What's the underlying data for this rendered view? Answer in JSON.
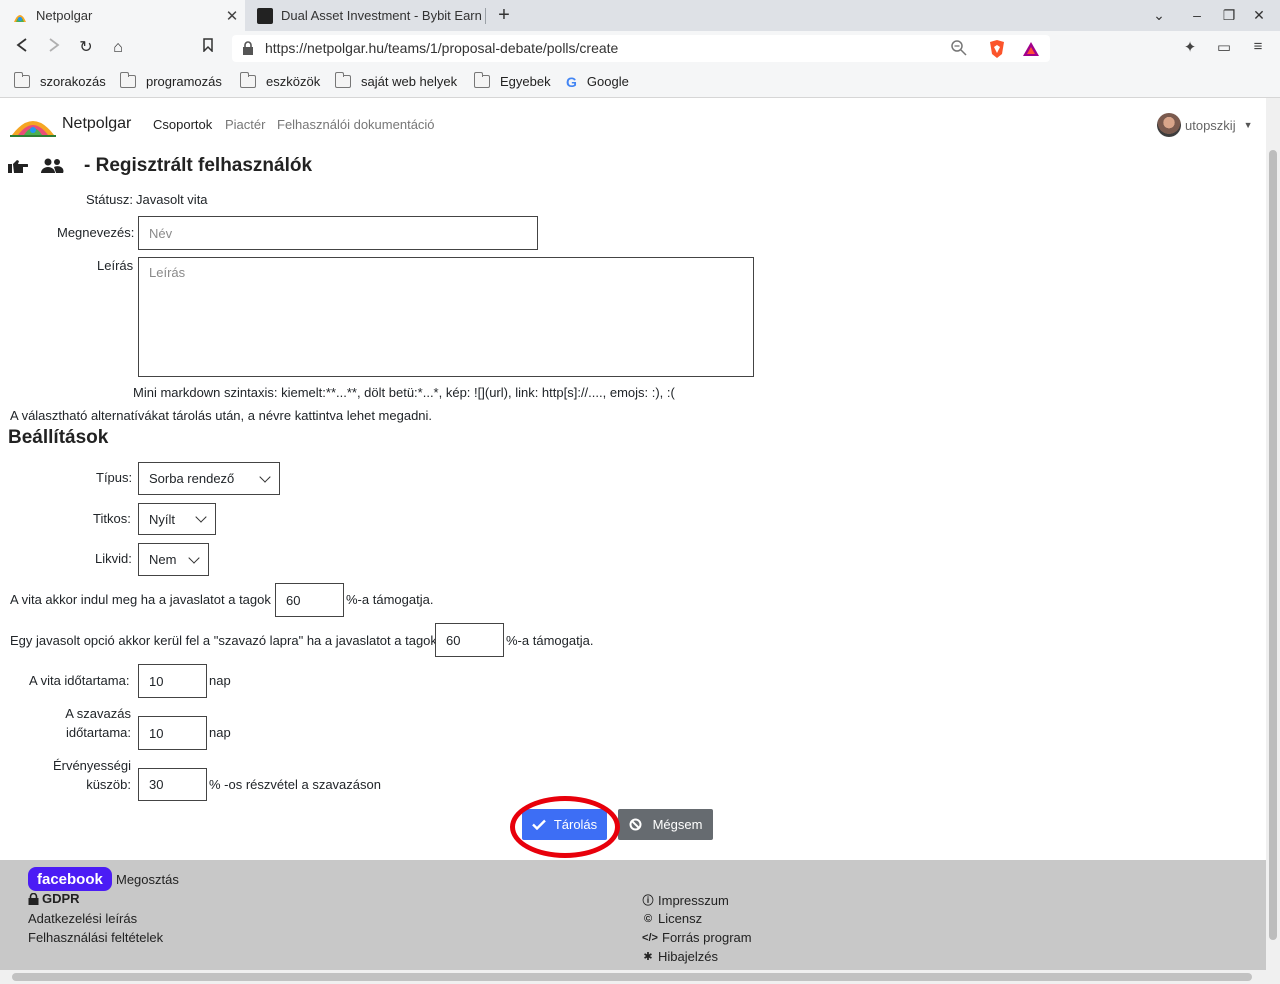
{
  "browser": {
    "tabs": [
      {
        "title": "Netpolgar",
        "active": true
      },
      {
        "title": "Dual Asset Investment - Bybit Earn",
        "active": false
      }
    ],
    "url": "https://netpolgar.hu/teams/1/proposal-debate/polls/create",
    "url_domain": "netpolgar.hu",
    "bookmarks": [
      "szorakozás",
      "programozás",
      "eszközök",
      "saját web helyek",
      "Egyebek",
      "Google"
    ]
  },
  "nav": {
    "brand": "Netpolgar",
    "links": [
      "Csoportok",
      "Piactér",
      "Felhasználói dokumentáció"
    ],
    "user": "utopszkij"
  },
  "header": {
    "title": "- Regisztrált felhasználók"
  },
  "form": {
    "status_label": "Státusz:",
    "status_value": "Javasolt vita",
    "name_label": "Megnevezés:",
    "name_placeholder": "Név",
    "desc_label": "Leírás",
    "desc_placeholder": "Leírás",
    "markdown_hint": "Mini markdown szintaxis: kiemelt:**...**, dölt betü:*...*, kép: ![](url), link: http[s]://...., emojs: :), :(",
    "alt_hint": "A választható alternatívákat tárolás után, a névre kattintva lehet megadni."
  },
  "settings": {
    "title": "Beállítások",
    "type_label": "Típus:",
    "type_value": "Sorba rendező",
    "secret_label": "Titkos:",
    "secret_value": "Nyílt",
    "liquid_label": "Likvid:",
    "liquid_value": "Nem",
    "start_pre": "A vita akkor indul meg ha a javaslatot a tagok",
    "start_value": "60",
    "start_post": "%-a támogatja.",
    "option_pre": "Egy javasolt opció akkor kerül fel a \"szavazó lapra\" ha a javaslatot a tagok",
    "option_value": "60",
    "option_post": "%-a támogatja.",
    "debate_label": "A vita időtartama:",
    "debate_value": "10",
    "debate_unit": "nap",
    "vote_label_1": "A szavazás",
    "vote_label_2": "időtartama:",
    "vote_value": "10",
    "vote_unit": "nap",
    "valid_label_1": "Érvényességi",
    "valid_label_2": "küszöb:",
    "valid_value": "30",
    "valid_unit": "% -os részvétel a szavazáson"
  },
  "buttons": {
    "save": "Tárolás",
    "cancel": "Mégsem"
  },
  "footer": {
    "facebook": "facebook",
    "share": "Megosztás",
    "gdpr": "GDPR",
    "privacy": "Adatkezelési leírás",
    "terms": "Felhasználási feltételek",
    "impressum": "Impresszum",
    "license": "Licensz",
    "source": "Forrás program",
    "bugreport": "Hibajelzés"
  },
  "colors": {
    "primary": "#3d6ef5",
    "secondary": "#666b70",
    "highlight": "#e8000b",
    "facebook": "#4b1cf5",
    "footer_bg": "#c8c8c8"
  }
}
